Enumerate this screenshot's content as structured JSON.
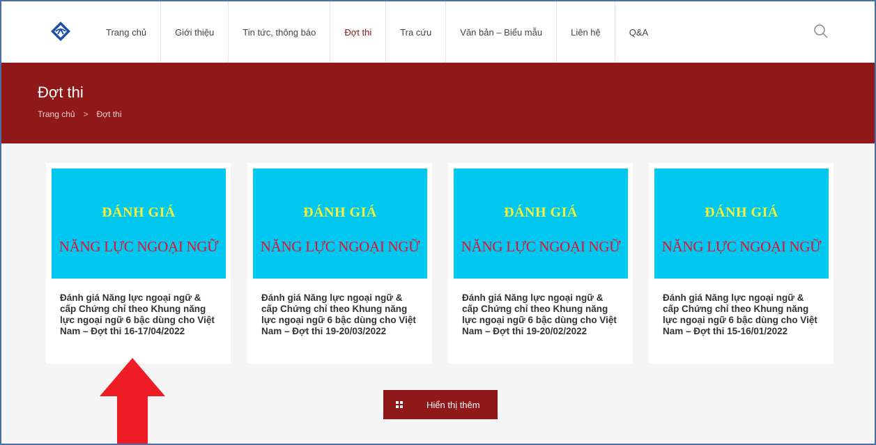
{
  "header": {
    "logo_icon": "diamond-logo-icon",
    "nav": [
      {
        "label": "Trang chủ"
      },
      {
        "label": "Giới thiệu"
      },
      {
        "label": "Tin tức, thông báo"
      },
      {
        "label": "Đợt thi",
        "active": true
      },
      {
        "label": "Tra cứu"
      },
      {
        "label": "Văn bản – Biểu mẫu"
      },
      {
        "label": "Liên hệ"
      },
      {
        "label": "Q&A"
      }
    ],
    "search_icon": "search-icon"
  },
  "banner": {
    "title": "Đợt thi",
    "breadcrumb": {
      "home": "Trang chủ",
      "separator": ">",
      "current": "Đợt thi"
    }
  },
  "cards": [
    {
      "image_line1": "ĐÁNH GIÁ",
      "image_line2": "NĂNG LỰC NGOẠI NGỮ",
      "title": "Đánh giá Năng lực ngoại ngữ & cấp Chứng chỉ theo Khung năng lực ngoại ngữ 6 bậc dùng cho Việt Nam – Đợt thi 16-17/04/2022"
    },
    {
      "image_line1": "ĐÁNH GIÁ",
      "image_line2": "NĂNG LỰC NGOẠI NGỮ",
      "title": "Đánh giá Năng lực ngoại ngữ & cấp Chứng chỉ theo Khung năng lực ngoại ngữ 6 bậc dùng cho Việt Nam – Đợt thi 19-20/03/2022"
    },
    {
      "image_line1": "ĐÁNH GIÁ",
      "image_line2": "NĂNG LỰC NGOẠI NGỮ",
      "title": "Đánh giá Năng lực ngoại ngữ & cấp Chứng chỉ theo Khung năng lực ngoại ngữ 6 bậc dùng cho Việt Nam – Đợt thi 19-20/02/2022"
    },
    {
      "image_line1": "ĐÁNH GIÁ",
      "image_line2": "NĂNG LỰC NGOẠI NGỮ",
      "title": "Đánh giá Năng lực ngoại ngữ & cấp Chứng chỉ theo Khung năng lực ngoại ngữ 6 bậc dùng cho Việt Nam – Đợt thi 15-16/01/2022"
    }
  ],
  "load_more": {
    "label": "Hiển thị thêm",
    "icon": "grid-icon"
  },
  "colors": {
    "brand": "#8f1919",
    "card_image_bg": "#00c8f0",
    "image_line1": "#f4f03a",
    "image_line2": "#e8102a",
    "arrow": "#ee1c25"
  },
  "annotation": {
    "arrow_icon": "red-up-arrow-icon"
  }
}
